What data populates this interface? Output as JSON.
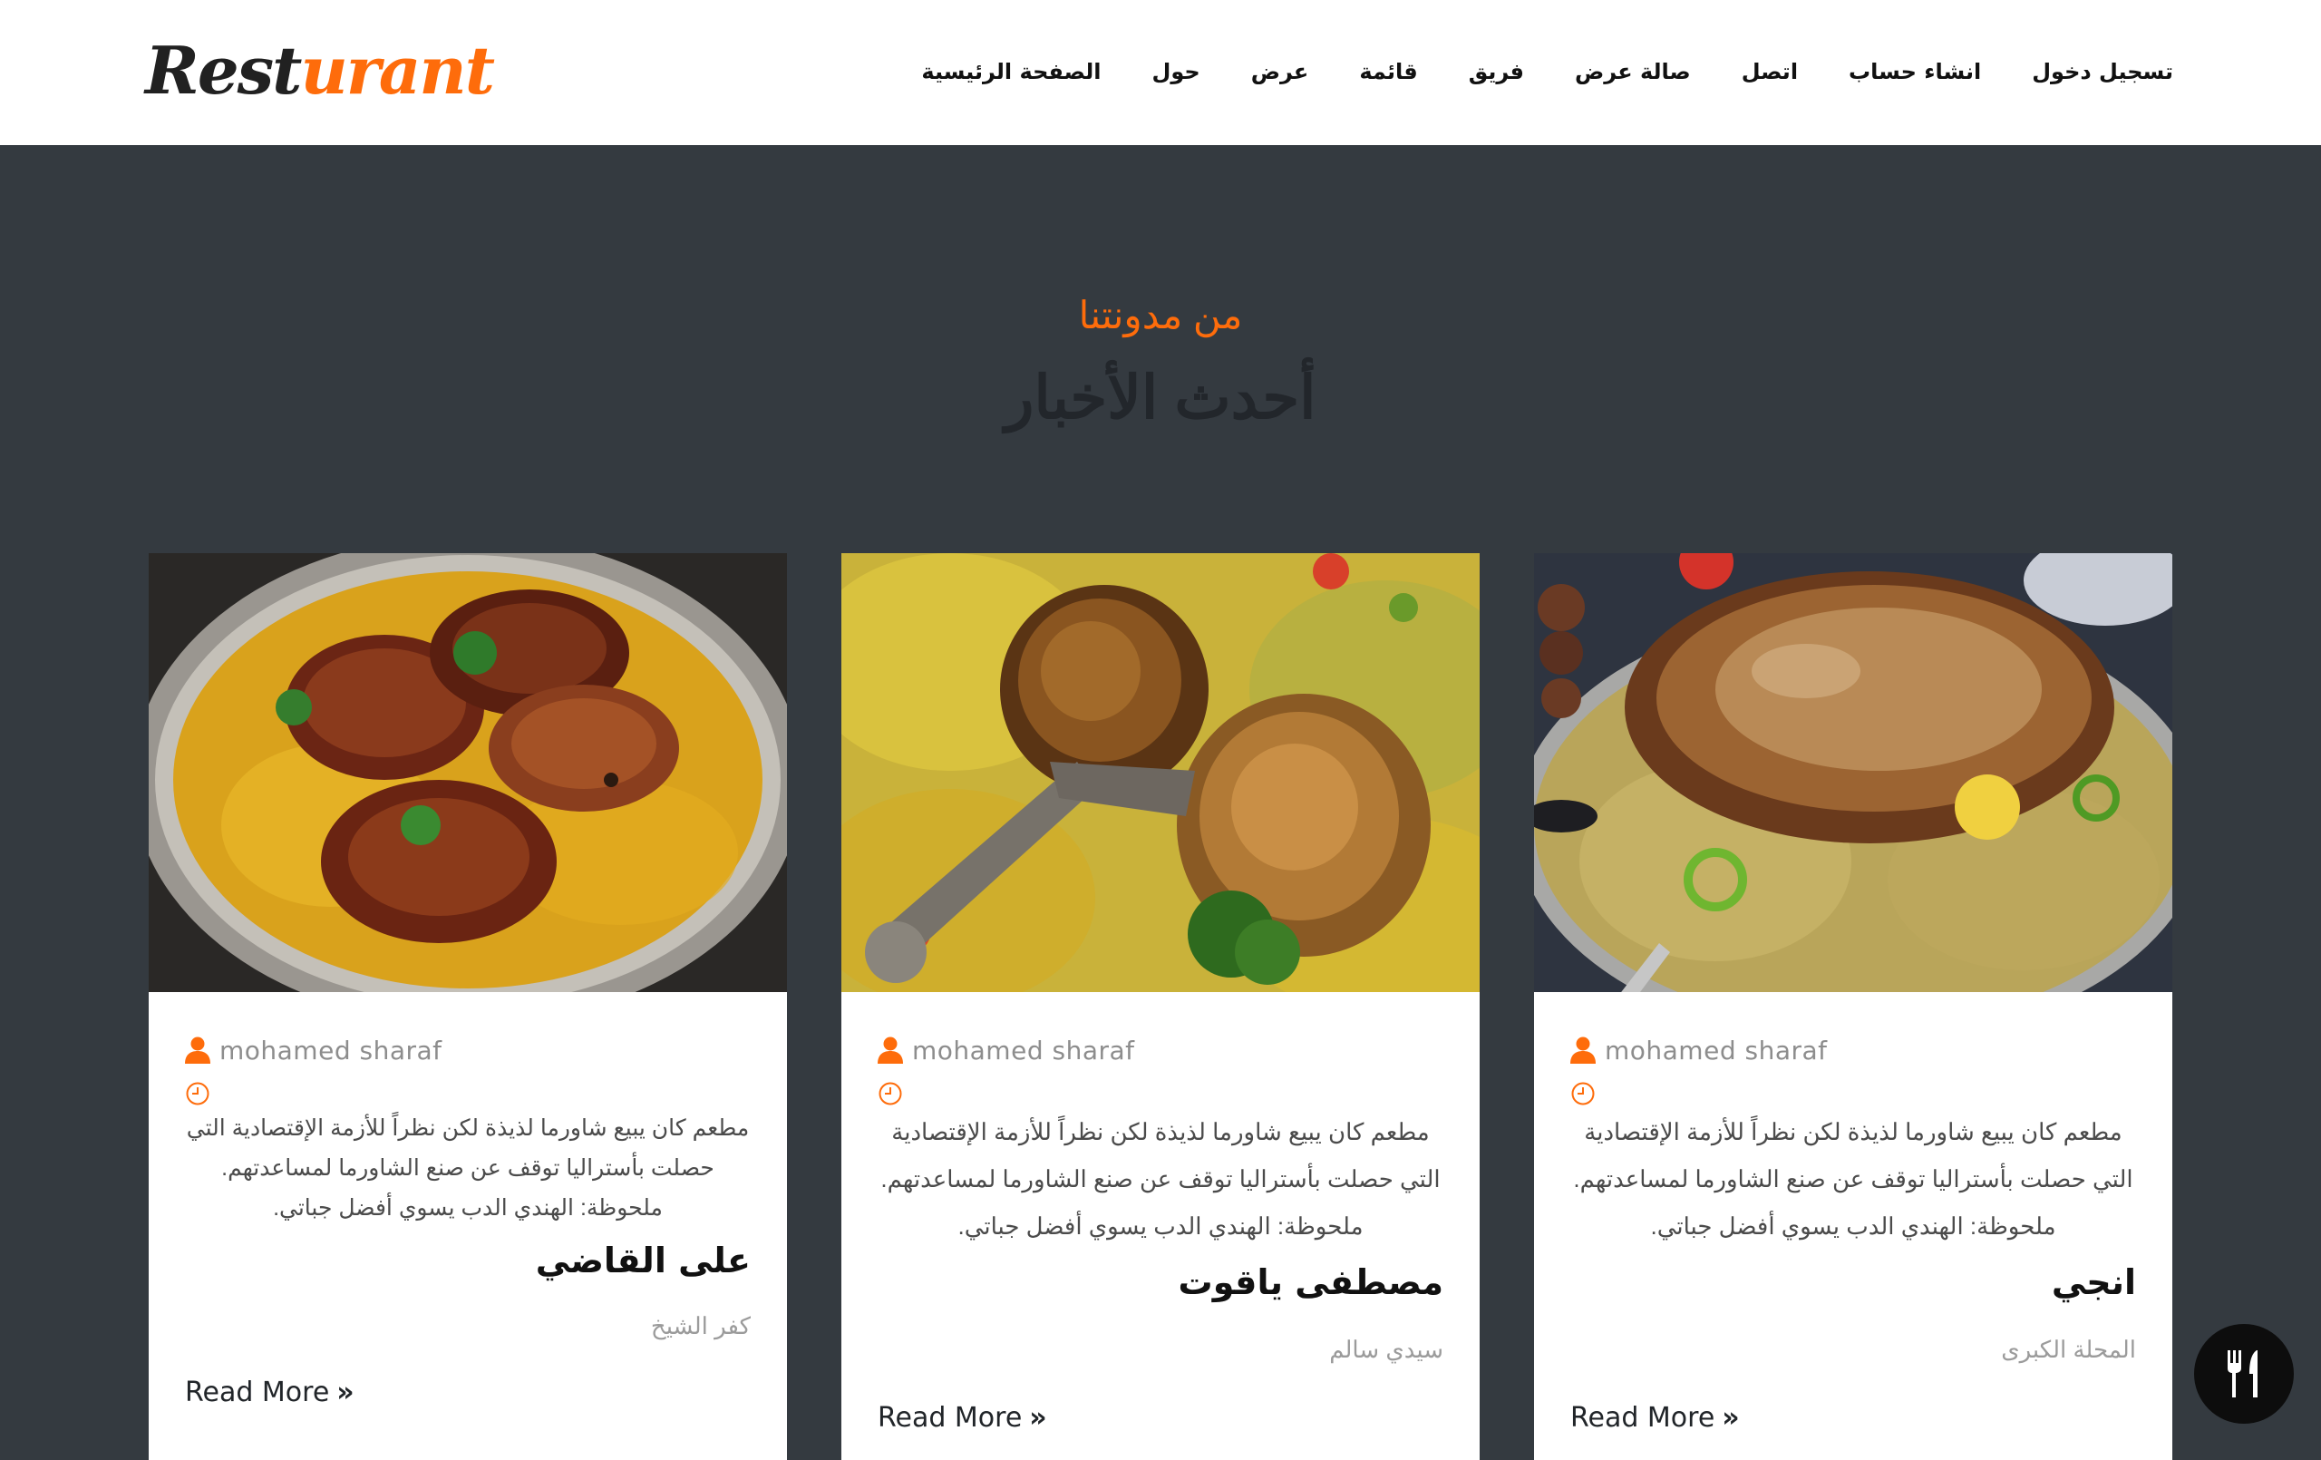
{
  "brand": {
    "logo_part1": "Rest",
    "logo_part2": "urant"
  },
  "nav": {
    "items": [
      {
        "key": "login",
        "label": "تسجيل دخول"
      },
      {
        "key": "signup",
        "label": "انشاء حساب"
      },
      {
        "key": "contact",
        "label": "اتصل"
      },
      {
        "key": "showroom",
        "label": "صالة عرض"
      },
      {
        "key": "team",
        "label": "فريق"
      },
      {
        "key": "menu",
        "label": "قائمة"
      },
      {
        "key": "offer",
        "label": "عرض"
      },
      {
        "key": "about",
        "label": "حول"
      },
      {
        "key": "home",
        "label": "الصفحة الرئيسية"
      }
    ]
  },
  "blog": {
    "eyebrow": "من مدونتنا",
    "title": "أحدث الأخبار",
    "posts": [
      {
        "author": "mohamed sharaf",
        "excerpt": "مطعم كان يبيع شاورما لذيذة لكن نظراً للأزمة الإقتصادية التي حصلت بأستراليا توقف عن صنع الشاورما لمساعدتهم. ملحوظة: الهندي الدب يسوي أفضل جباتي.",
        "title": "على القاضي",
        "location": "كفر الشيخ",
        "read_more": "Read More",
        "image": "rice-with-glazed-chicken-thighs"
      },
      {
        "author": "mohamed sharaf",
        "excerpt": "مطعم كان يبيع شاورما لذيذة لكن نظراً للأزمة الإقتصادية التي حصلت بأستراليا توقف عن صنع الشاورما لمساعدتهم. ملحوظة: الهندي الدب يسوي أفضل جباتي.",
        "title": "مصطفى ياقوت",
        "location": "سيدي سالم",
        "read_more": "Read More",
        "image": "rice-with-roasted-drumsticks"
      },
      {
        "author": "mohamed sharaf",
        "excerpt": "مطعم كان يبيع شاورما لذيذة لكن نظراً للأزمة الإقتصادية التي حصلت بأستراليا توقف عن صنع الشاورما لمساعدتهم. ملحوظة: الهندي الدب يسوي أفضل جباتي.",
        "title": "انجي",
        "location": "المحلة الكبرى",
        "read_more": "Read More",
        "image": "rice-with-roasted-lamb"
      }
    ]
  },
  "icons": {
    "author": "user-icon",
    "date": "clock-icon",
    "read_more": "double-chevron-right-icon",
    "fab": "cutlery-icon"
  },
  "colors": {
    "accent": "#fe6c0b",
    "section_bg": "#343a40",
    "card_bg": "#ffffff",
    "header_bg": "#ffffff"
  }
}
